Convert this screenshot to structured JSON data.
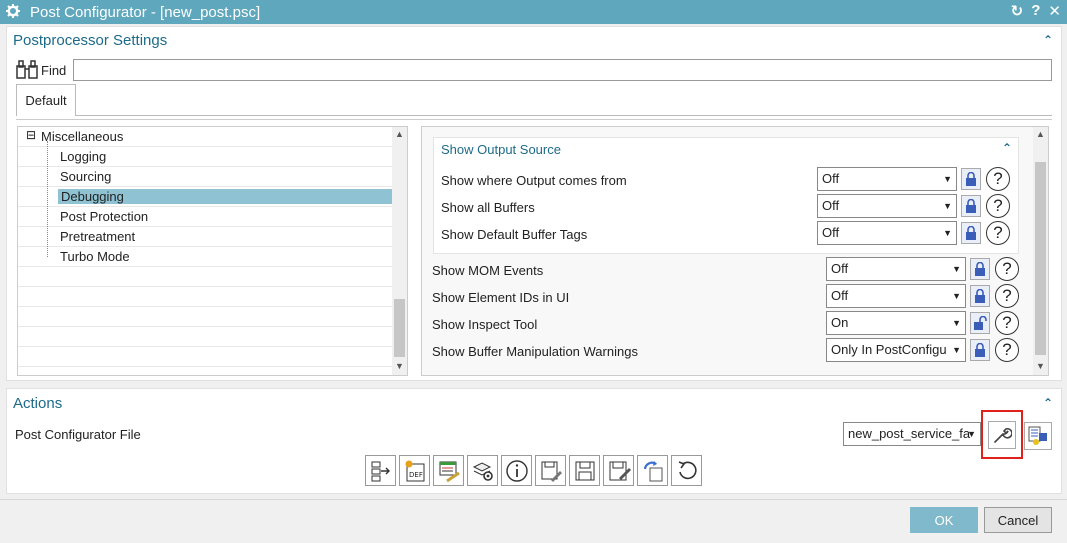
{
  "window": {
    "title": "Post Configurator - [new_post.psc]",
    "controls": [
      "↻",
      "?",
      "✕"
    ]
  },
  "settings": {
    "title": "Postprocessor Settings",
    "find_label": "Find",
    "find_value": "",
    "tab": "Default",
    "tree": {
      "parent": "Miscellaneous",
      "items": [
        "Logging",
        "Sourcing",
        "Debugging",
        "Post Protection",
        "Pretreatment",
        "Turbo Mode"
      ],
      "selected": "Debugging"
    },
    "group": {
      "title": "Show Output Source",
      "rows": [
        {
          "label": "Show where Output comes from",
          "value": "Off",
          "lock": "locked"
        },
        {
          "label": "Show all Buffers",
          "value": "Off",
          "lock": "locked"
        },
        {
          "label": "Show Default Buffer Tags",
          "value": "Off",
          "lock": "locked"
        }
      ]
    },
    "rows": [
      {
        "label": "Show MOM Events",
        "value": "Off",
        "lock": "locked"
      },
      {
        "label": "Show Element IDs in UI",
        "value": "Off",
        "lock": "locked"
      },
      {
        "label": "Show Inspect Tool",
        "value": "On",
        "lock": "unlocked"
      },
      {
        "label": "Show Buffer Manipulation Warnings",
        "value": "Only In PostConfigu",
        "lock": "locked"
      }
    ]
  },
  "actions": {
    "title": "Actions",
    "file_label": "Post Configurator File",
    "file_value": "new_post_service_fa",
    "toolbar_icons": [
      "export-icon",
      "def-file-icon",
      "editor-icon",
      "settings-icon",
      "info-icon",
      "save-as-icon",
      "save-icon",
      "save-edit-icon",
      "refresh-icon",
      "undo-icon"
    ],
    "highlight_color": "#e0201b"
  },
  "footer": {
    "ok": "OK",
    "cancel": "Cancel"
  },
  "colors": {
    "accent": "#5ea7bd",
    "heading": "#1d6a8a",
    "selection": "#8fc3d3",
    "ok_button": "#7fb9cb"
  }
}
